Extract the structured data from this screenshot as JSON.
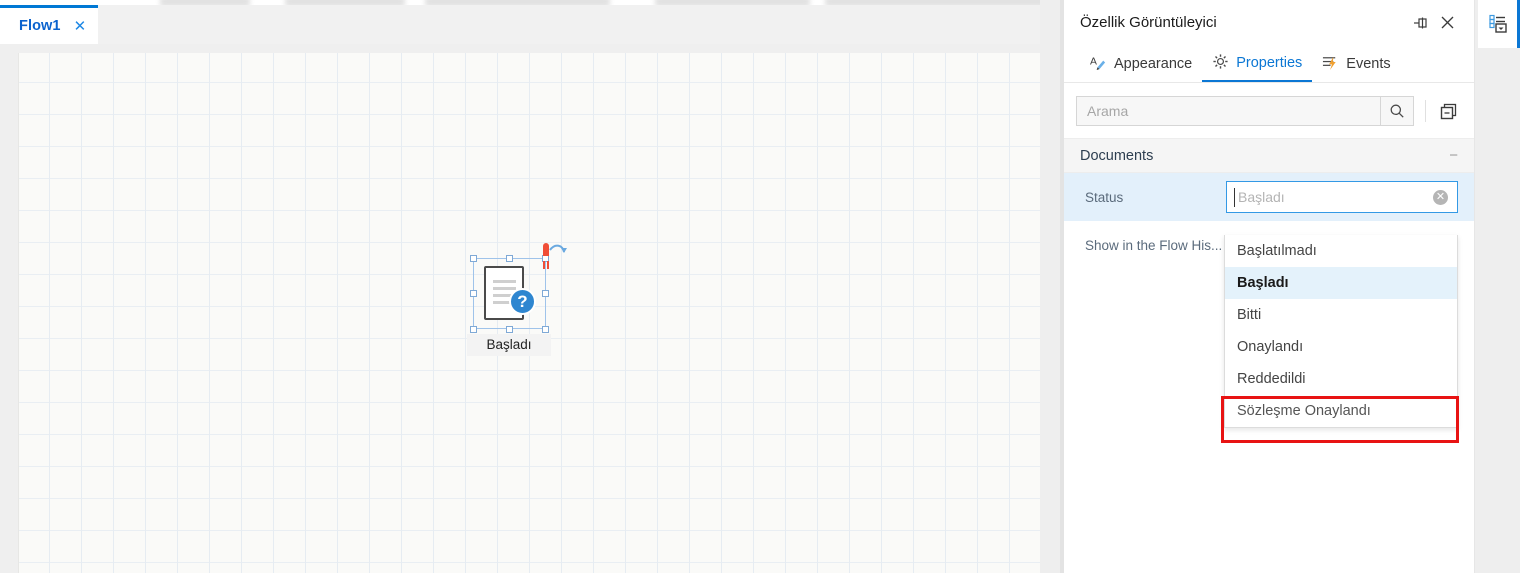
{
  "tab_bar": {
    "tabs": [
      {
        "label": "Flow1",
        "close_icon": "close-icon",
        "active": true
      }
    ]
  },
  "canvas": {
    "node": {
      "label": "Başladı",
      "icon": "document-question-icon",
      "badge": "?",
      "marker_icon": "red-pin-marker-icon",
      "rotate_icon": "rotate-handle-icon",
      "selected": true
    }
  },
  "panel": {
    "title": "Özellik Görüntüleyici",
    "pin_icon": "pin-icon",
    "close_icon": "close-icon",
    "tabs": [
      {
        "label": "Appearance",
        "icon": "appearance-pencil-icon",
        "active": false
      },
      {
        "label": "Properties",
        "icon": "gear-icon",
        "active": true
      },
      {
        "label": "Events",
        "icon": "events-lightning-icon",
        "active": false
      }
    ],
    "search": {
      "placeholder": "Arama",
      "value": "",
      "search_icon": "search-icon"
    },
    "collapse_all": {
      "icon": "collapse-all-icon"
    },
    "groups": [
      {
        "title": "Documents",
        "toggle": "−",
        "rows": [
          {
            "label": "Status",
            "type": "combobox",
            "value": "",
            "placeholder": "Başladı",
            "clear_icon": "clear-circle-icon",
            "selected": true
          },
          {
            "label": "Show in the Flow His...",
            "type": "text",
            "value": "",
            "selected": false
          }
        ]
      }
    ],
    "dropdown": {
      "open": true,
      "options": [
        {
          "label": "Başlatılmadı",
          "highlight": false,
          "annotated": false
        },
        {
          "label": "Başladı",
          "highlight": true,
          "annotated": false
        },
        {
          "label": "Bitti",
          "highlight": false,
          "annotated": false
        },
        {
          "label": "Onaylandı",
          "highlight": false,
          "annotated": false
        },
        {
          "label": "Reddedildi",
          "highlight": false,
          "annotated": false
        },
        {
          "label": "Sözleşme Onaylandı",
          "highlight": false,
          "annotated": true
        }
      ]
    }
  },
  "right_rail": {
    "buttons": [
      {
        "icon": "properties-list-icon",
        "active": true
      }
    ]
  },
  "colors": {
    "accent": "#0b77d4",
    "tab_text": "#0b63ce",
    "annotation_red": "#e81313",
    "selected_row": "#e3f0fb",
    "highlight_row": "#e4f2fb",
    "badge_blue": "#2e86d0",
    "marker_red": "#f04e37"
  }
}
